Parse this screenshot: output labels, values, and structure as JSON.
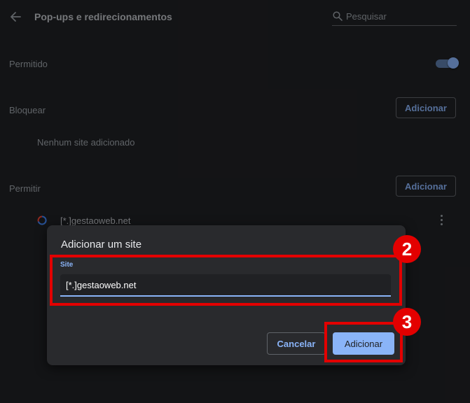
{
  "header": {
    "title": "Pop-ups e redirecionamentos",
    "search": {
      "placeholder": "Pesquisar",
      "value": ""
    }
  },
  "settings": {
    "permitted": {
      "label": "Permitido",
      "enabled": true
    },
    "block": {
      "label": "Bloquear",
      "add_label": "Adicionar",
      "empty_text": "Nenhum site adicionado"
    },
    "allow": {
      "label": "Permitir",
      "add_label": "Adicionar",
      "sites": [
        "[*.]gestaoweb.net"
      ]
    }
  },
  "dialog": {
    "title": "Adicionar um site",
    "field_label": "Site",
    "field_value": "[*.]gestaoweb.net",
    "cancel_label": "Cancelar",
    "confirm_label": "Adicionar"
  },
  "annotations": {
    "steps": [
      "2",
      "3"
    ],
    "color": "#e30000"
  },
  "colors": {
    "background": "#202124",
    "dialog": "#292a2d",
    "accent": "#8ab4f8"
  },
  "icons": [
    "back-arrow-icon",
    "search-icon",
    "site-favicon-icon",
    "more-vert-icon"
  ]
}
